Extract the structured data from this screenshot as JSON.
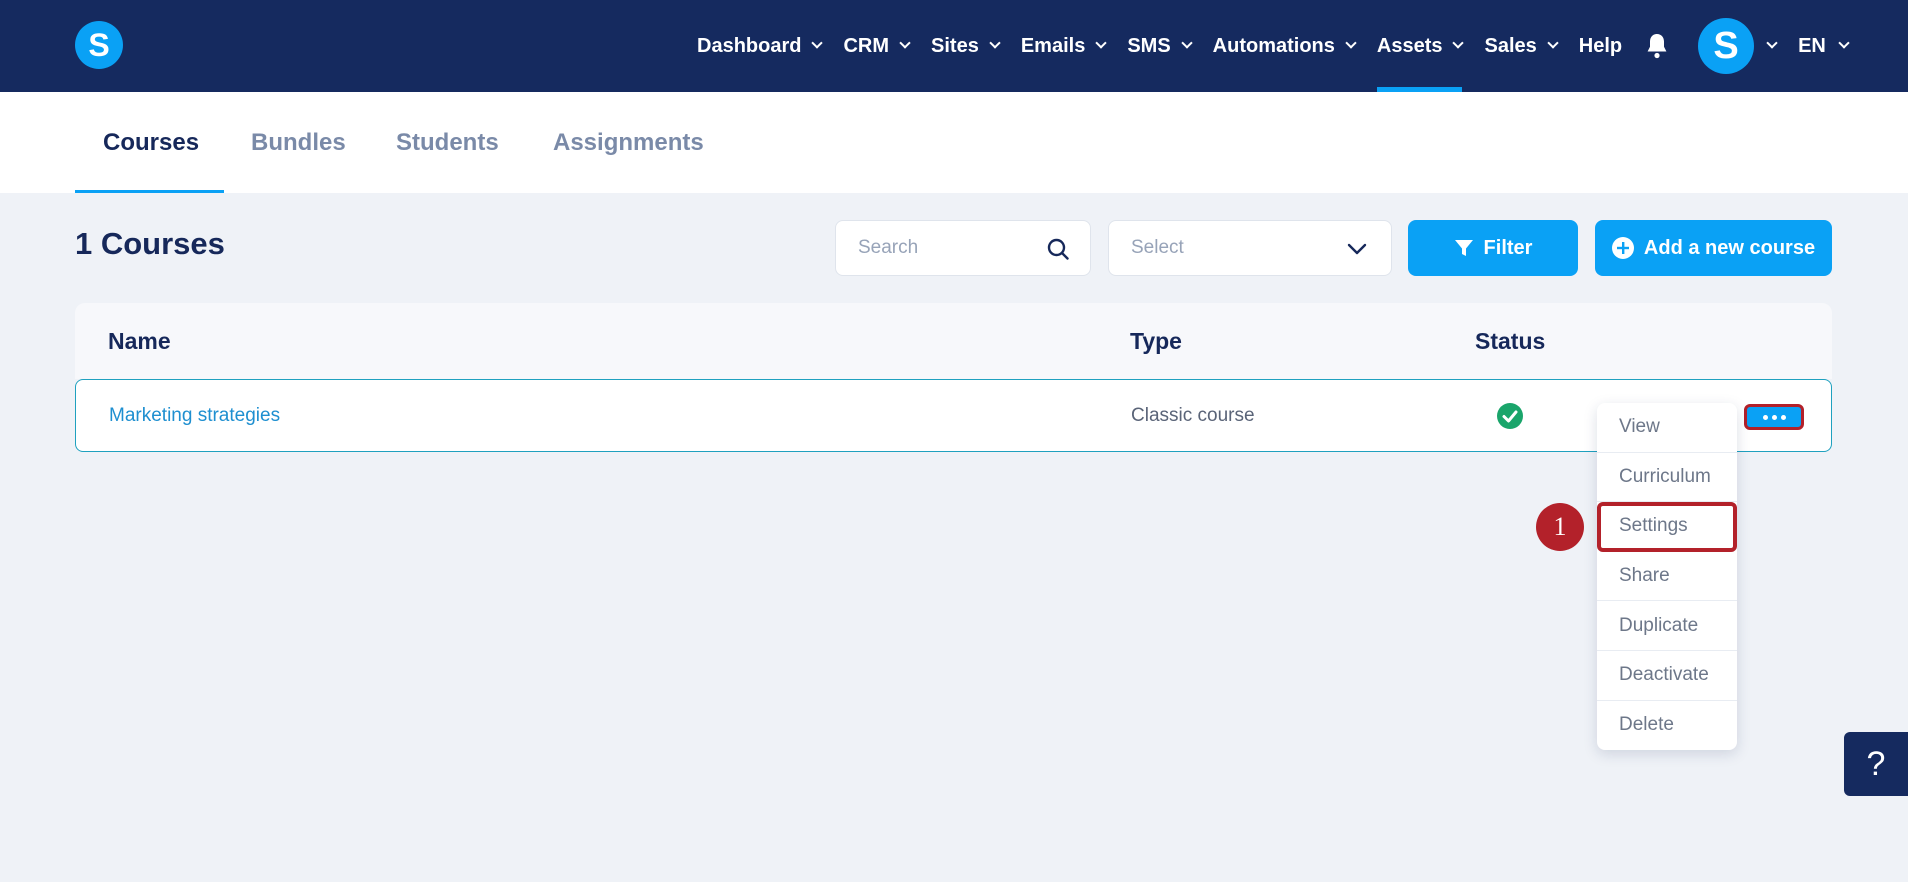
{
  "header": {
    "logo_letter": "S",
    "nav": [
      {
        "label": "Dashboard",
        "has_dropdown": true
      },
      {
        "label": "CRM",
        "has_dropdown": true
      },
      {
        "label": "Sites",
        "has_dropdown": true
      },
      {
        "label": "Emails",
        "has_dropdown": true
      },
      {
        "label": "SMS",
        "has_dropdown": true
      },
      {
        "label": "Automations",
        "has_dropdown": true
      },
      {
        "label": "Assets",
        "has_dropdown": true,
        "active": true
      },
      {
        "label": "Sales",
        "has_dropdown": true
      },
      {
        "label": "Help",
        "has_dropdown": false
      }
    ],
    "avatar_letter": "S",
    "language": "EN"
  },
  "tabs": [
    {
      "label": "Courses",
      "active": true
    },
    {
      "label": "Bundles"
    },
    {
      "label": "Students"
    },
    {
      "label": "Assignments"
    }
  ],
  "page": {
    "title": "1 Courses",
    "search_placeholder": "Search",
    "select_placeholder": "Select",
    "filter_label": "Filter",
    "add_label": "Add a new course"
  },
  "table": {
    "columns": [
      "Name",
      "Type",
      "Status"
    ],
    "rows": [
      {
        "name": "Marketing strategies",
        "type": "Classic course",
        "status": "active"
      }
    ]
  },
  "row_menu": {
    "items": [
      "View",
      "Curriculum",
      "Settings",
      "Share",
      "Duplicate",
      "Deactivate",
      "Delete"
    ],
    "highlighted": "Settings"
  },
  "annotation": {
    "step": "1"
  },
  "help_button": "?",
  "colors": {
    "navbar": "#152a5f",
    "accent": "#0aa1f5",
    "highlight": "#b3212a",
    "status_ok": "#1aa56b",
    "page_bg": "#eff2f7"
  }
}
